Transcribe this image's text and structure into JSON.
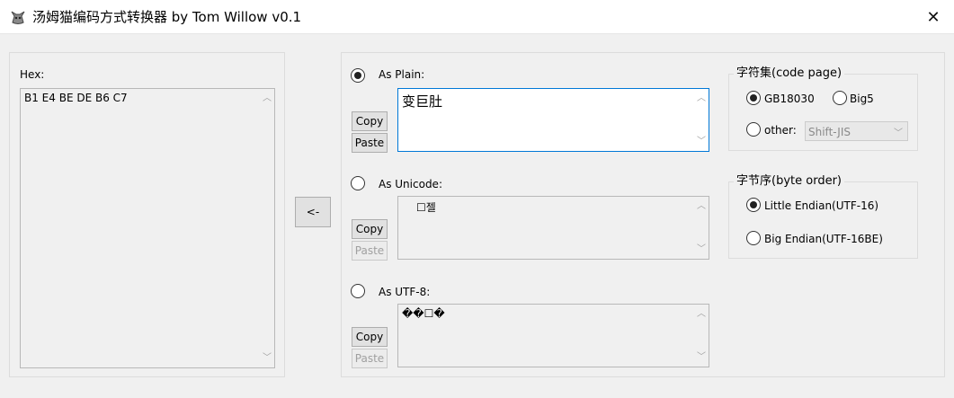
{
  "window": {
    "title": "汤姆猫编码方式转换器 by Tom Willow v0.1",
    "close_glyph": "✕",
    "icon": "cat-icon"
  },
  "hex": {
    "label": "Hex:",
    "value": "B1 E4 BE DE B6 C7"
  },
  "convert_button": {
    "label": "<-"
  },
  "plain": {
    "label": "As Plain:",
    "value": "变巨肚",
    "copy": "Copy",
    "paste": "Paste",
    "selected": true
  },
  "unicode": {
    "label": "As Unicode:",
    "value": "☐젤",
    "copy": "Copy",
    "paste": "Paste",
    "selected": false
  },
  "utf8": {
    "label": "As UTF-8:",
    "value": "��☐�",
    "copy": "Copy",
    "paste": "Paste",
    "selected": false
  },
  "charset": {
    "title": "字符集(code page)",
    "gb18030": "GB18030",
    "big5": "Big5",
    "other": "other:",
    "other_value": "Shift-JIS",
    "selected": "GB18030"
  },
  "byte_order": {
    "title": "字节序(byte order)",
    "little": "Little Endian(UTF-16)",
    "big": "Big Endian(UTF-16BE)",
    "selected": "Little Endian(UTF-16)"
  },
  "colors": {
    "focus_border": "#0078d7",
    "background": "#f0f0f0"
  }
}
